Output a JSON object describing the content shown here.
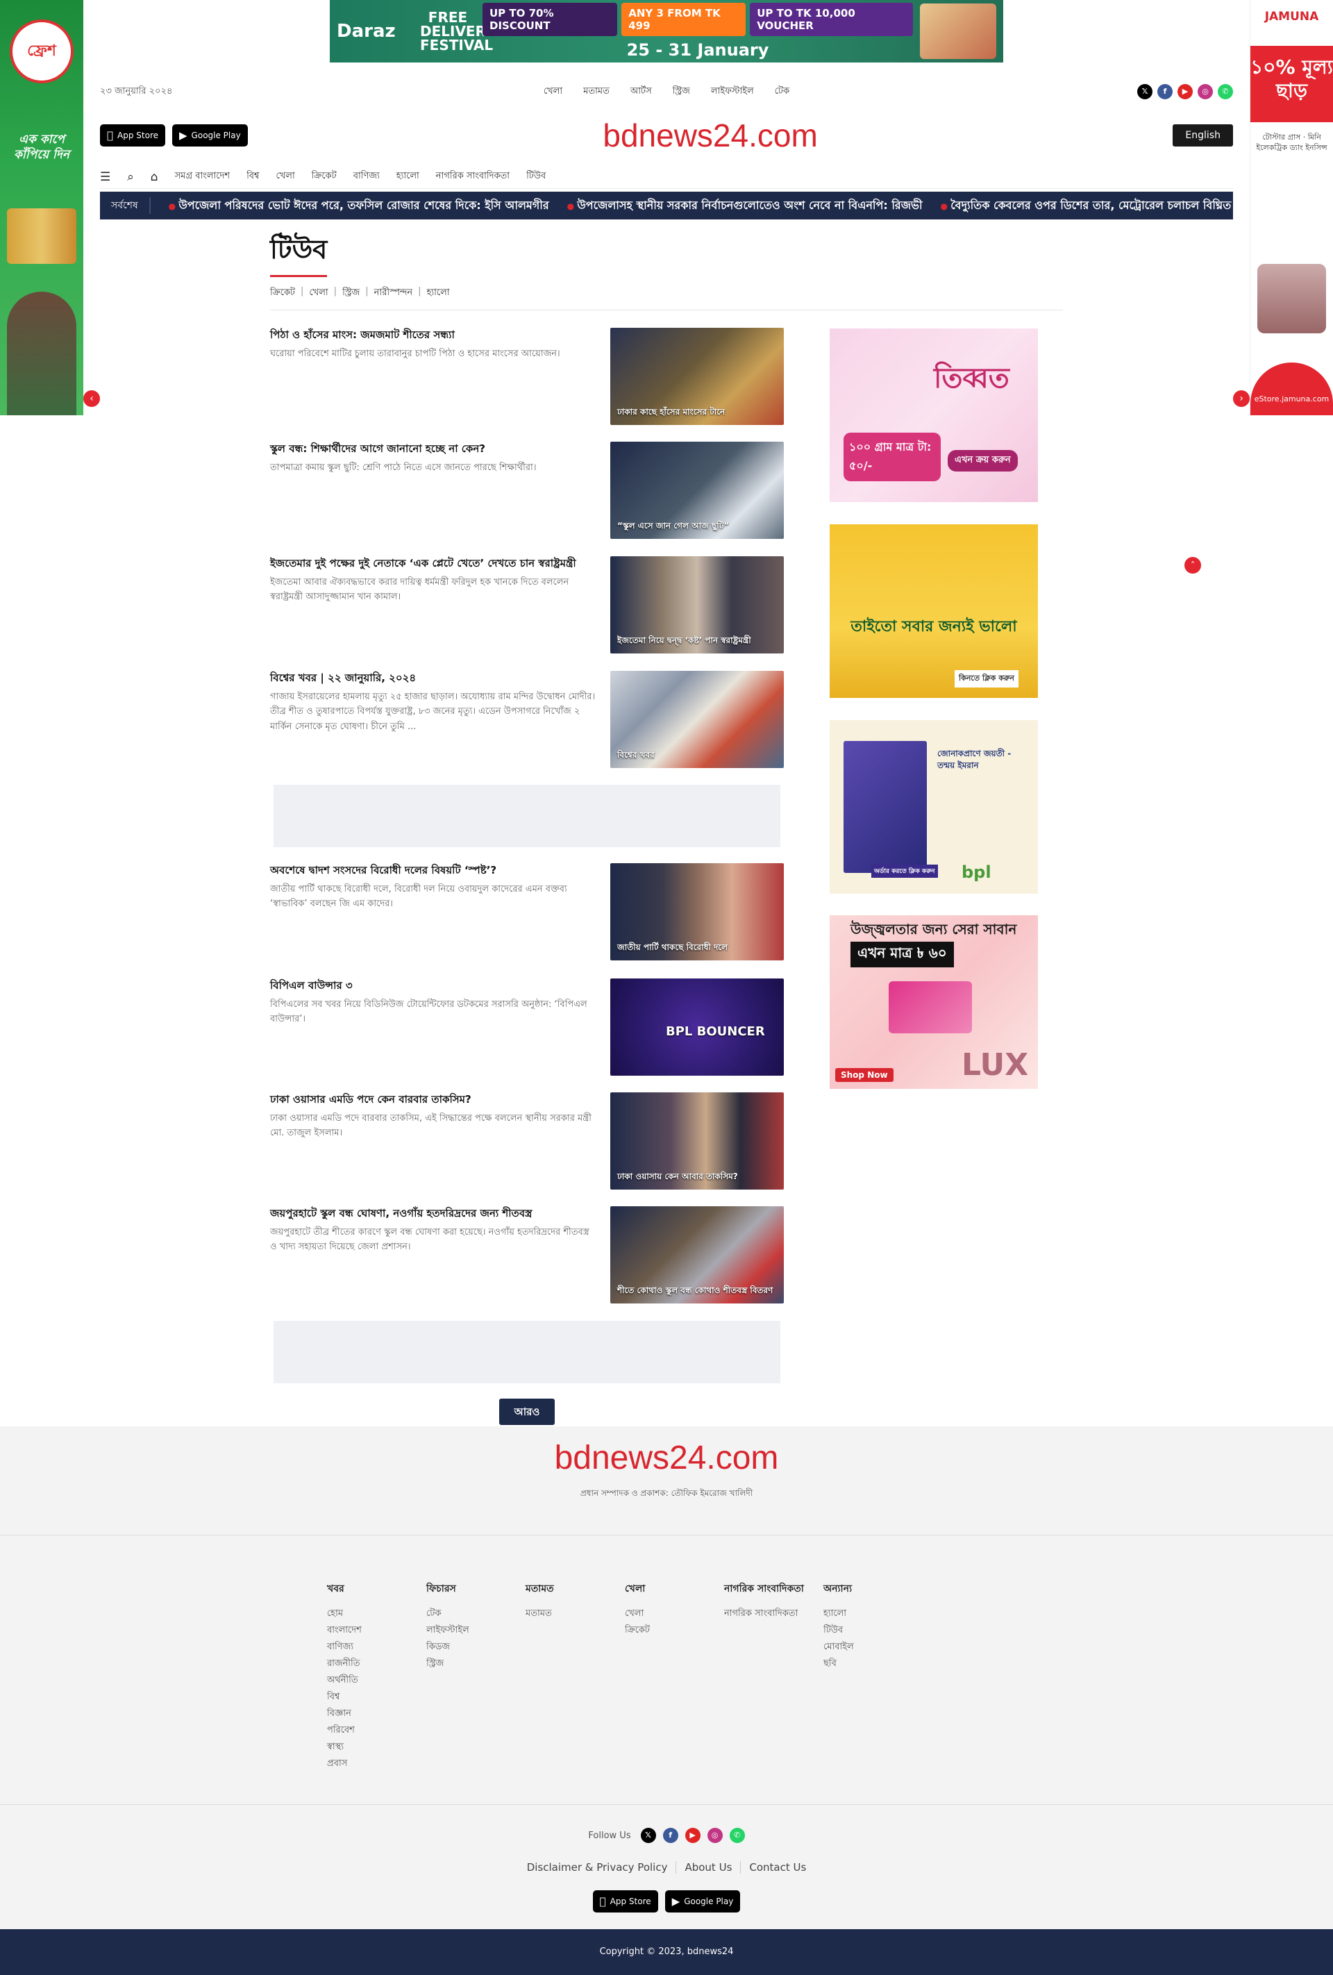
{
  "side_ads": {
    "left": {
      "logo": "ফ্রেশ",
      "slogan": "এক কাপে কাঁপিয়ে দিন"
    },
    "right": {
      "brand": "JAMUNA",
      "offer": "১০% মূল্য ছাড়",
      "items": "টোস্টার গ্রাস · মিনি ইলেকট্রিক ড্যাং ইনসিন্স",
      "store": "eStore.jamuna.com"
    }
  },
  "top_banner": {
    "brand": "Daraz",
    "festival": "FREE DELIVERY FESTIVAL",
    "chips": [
      "UP TO 70% DISCOUNT",
      "ANY 3 FROM TK 499",
      "UP TO TK 10,000 VOUCHER"
    ],
    "dates": "25 - 31 January"
  },
  "header": {
    "date": "২৩ জানুয়ারি ২০২৪",
    "top_nav": [
      "খেলা",
      "মতামত",
      "আর্টস",
      "স্ট্রিজ",
      "লাইফস্টাইল",
      "টেক"
    ],
    "app_store": "App Store",
    "google_play": "Google Play",
    "logo": "bdnews24.com",
    "lang_button": "English"
  },
  "cat_nav": [
    "সমগ্র বাংলাদেশ",
    "বিশ্ব",
    "খেলা",
    "ক্রিকেট",
    "বাণিজ্য",
    "হ্যালো",
    "নাগরিক সাংবাদিকতা",
    "টিউব"
  ],
  "ticker": {
    "label": "সর্বশেষ",
    "items": [
      "উপজেলা পরিষদের ভোট ঈদের পরে, তফসিল রোজার শেষের দিকে: ইসি আলমগীর",
      "উপজেলাসহ স্থানীয় সরকার নির্বাচনগুলোতেও অংশ নেবে না বিএনপি: রিজভী",
      "বৈদ্যুতিক কেবলের ওপর ডিশের তার, মেট্রোরেল চলাচল বিঘ্নিত"
    ]
  },
  "section": {
    "title": "টিউব",
    "sub_categories": [
      "ক্রিকেট",
      "খেলা",
      "স্ট্রিজ",
      "নারীস্পন্দন",
      "হ্যালো"
    ]
  },
  "articles": [
    {
      "title": "পিঠা ও হাঁসের মাংস: জমজমাট শীতের সন্ধ্যা",
      "summary": "ঘরোয়া পরিবেশে মাটির চুলায় তারাবানুর চাপটি পিঠা ও হাসের মাংসের আয়োজন।",
      "caption": "ঢাকার কাছে হাঁসের মাংসের টানে"
    },
    {
      "title": "স্কুল বন্ধ: শিক্ষার্থীদের আগে জানানো হচ্ছে না কেন?",
      "summary": "তাপমাত্রা কমায় স্কুল ছুটি: শ্রেণি পাঠে নিতে এসে জানতে পারছে শিক্ষার্থীরা।",
      "caption": "“স্কুল এসে জান গেল আজ ছুটি”"
    },
    {
      "title": "ইজতেমার দুই পক্ষের দুই নেতাকে ‘এক প্লেটে খেতে’ দেখতে চান স্বরাষ্ট্রমন্ত্রী",
      "summary": "ইজতেমা আবার ঐক্যবদ্ধভাবে করার দায়িত্ব ধর্মমন্ত্রী ফরিদুল হক খানকে দিতে বললেন স্বরাষ্ট্রমন্ত্রী আসাদুজ্জামান খান কামাল।",
      "caption": "ইজতেমা নিয়ে দ্বন্দ্ব ‘কষ্ট’ পান স্বরাষ্ট্রমন্ত্রী"
    },
    {
      "title": "বিশ্বের খবর | ২২ জানুয়ারি, ২০২৪",
      "summary": "গাজায় ইসরায়েলের হামলায় মৃত্যু ২৫ হাজার ছাড়াল। অযোধ্যায় রাম মন্দির উদ্বোধন মোদীর। তীব্র শীত ও তুষারপাতে বিপর্যস্ত যুক্তরাষ্ট্র, ৮৩ জনের মৃত্যু। এডেন উপসাগরে নিখোঁজ ২ মার্কিন সেনাকে মৃত ঘোষণা। চীনে তুমি ...",
      "caption": "বিশ্বের খবর"
    },
    {
      "title": "অবশেষে দ্বাদশ সংসদের বিরোধী দলের বিষয়টি ‘স্পষ্ট’?",
      "summary": "জাতীয় পার্টি থাকছে বিরোধী দলে, বিরোধী দল নিয়ে ওবায়দুল কাদেরের এমন বক্তব্য ‘স্বাভাবিক’ বলছেন জি এম কাদের।",
      "caption": "জাতীয় পার্টি থাকছে বিরোধী দলে"
    },
    {
      "title": "বিপিএল বাউন্সার ৩",
      "summary": "বিপিএলের সব খবর নিয়ে বিডিনিউজ টোয়েন্টিফোর ডটকমের সরাসরি অনুষ্ঠান: ‘বিপিএল বাউন্সার’।",
      "caption": "BPL BOUNCER"
    },
    {
      "title": "ঢাকা ওয়াসার এমডি পদে কেন বারবার তাকসিম?",
      "summary": "ঢাকা ওয়াসার এমডি পদে বারবার তাকসিম, এই সিদ্ধান্তের পক্ষে বললেন স্থানীয় সরকার মন্ত্রী মো. তাজুল ইসলাম।",
      "caption": "ঢাকা ওয়াসায় কেন আবার তাকসিম?"
    },
    {
      "title": "জয়পুরহাটে স্কুল বন্ধ ঘোষণা, নওগাঁয় হতদরিদ্রদের জন্য শীতবস্ত্র",
      "summary": "জয়পুরহাটে তীব্র শীতের কারণে স্কুল বন্ধ ঘোষণা করা হয়েছে। নওগাঁয় হতদরিদ্রদের শীতবস্ত্র ও খাদ্য সহায়তা দিয়েছে জেলা প্রশাসন।",
      "caption": "শীতে কোথাও স্কুল বন্ধ কোথাও শীতবস্ত্র বিতরণ"
    }
  ],
  "more_button": "আরও",
  "right_ads": [
    {
      "brand": "তিব্বত",
      "tag": "১০০ গ্রাম মাত্র টা: ৫০/-",
      "cta": "এখন ক্রয় করুন"
    },
    {
      "brand": "তাইতো সবার জন্যই ভালো",
      "cta": "কিনতে ক্লিক করুন"
    },
    {
      "brand": "bpl",
      "title": "জোনাকপ্রাণে জয়তী - তন্ময় ইমরান",
      "cta": "অর্ডার করতে ক্লিক করুন"
    },
    {
      "brand": "LUX",
      "title": "উজ্জ্বলতার জন্য সেরা সাবান",
      "price": "এখন মাত্র ৳ ৬০",
      "cta": "Shop Now"
    }
  ],
  "footer": {
    "logo": "bdnews24.com",
    "editor": "প্রধান সম্পাদক ও প্রকাশক: তৌফিক ইমরোজ খালিদী",
    "columns": [
      {
        "heading": "খবর",
        "links": [
          "হোম",
          "বাংলাদেশ",
          "বাণিজ্য",
          "রাজনীতি",
          "অর্থনীতি",
          "বিশ্ব",
          "বিজ্ঞান",
          "পরিবেশ",
          "স্বাস্থ্য",
          "প্রবাস"
        ]
      },
      {
        "heading": "ফিচারস",
        "links": [
          "টেক",
          "লাইফস্টাইল",
          "কিডজ",
          "স্ট্রিজ"
        ]
      },
      {
        "heading": "মতামত",
        "links": [
          "মতামত"
        ]
      },
      {
        "heading": "খেলা",
        "links": [
          "খেলা",
          "ক্রিকেট"
        ]
      },
      {
        "heading": "নাগরিক সাংবাদিকতা",
        "links": [
          "নাগরিক সাংবাদিকতা"
        ]
      },
      {
        "heading": "অন্যান্য",
        "links": [
          "হ্যালো",
          "টিউব",
          "মোবাইল",
          "ছবি"
        ]
      }
    ],
    "follow_label": "Follow Us",
    "links": [
      "Disclaimer & Privacy Policy",
      "About Us",
      "Contact Us"
    ],
    "copyright": "Copyright © 2023, bdnews24"
  },
  "colors": {
    "brand_red": "#d8262f",
    "navy": "#1e2a4a"
  }
}
